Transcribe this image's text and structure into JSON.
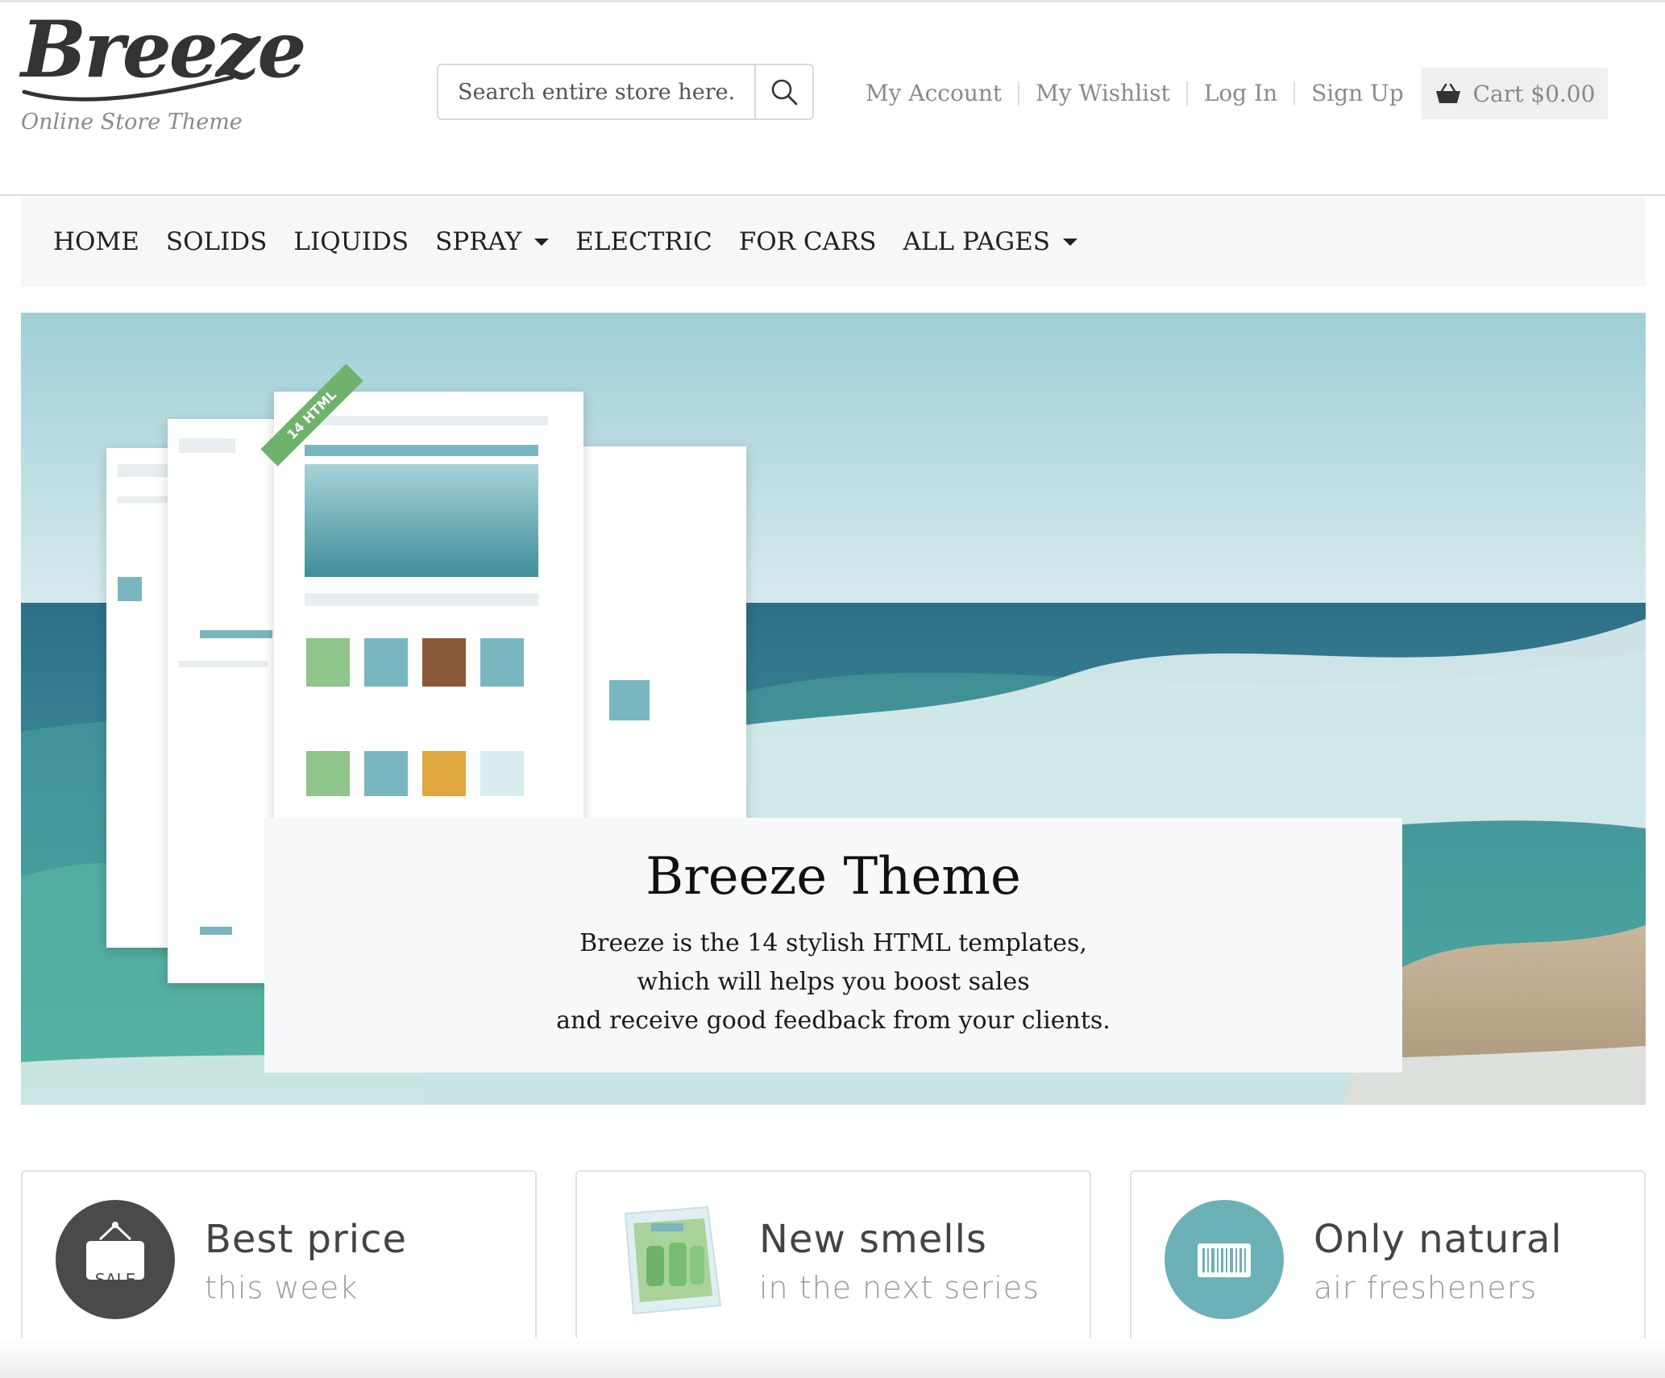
{
  "logo": {
    "name": "Breeze",
    "tagline": "Online Store Theme"
  },
  "search": {
    "placeholder": "Search entire store here..."
  },
  "account_links": [
    "My Account",
    "My Wishlist",
    "Log In",
    "Sign Up"
  ],
  "cart": {
    "label": "Cart $0.00"
  },
  "nav": [
    {
      "label": "HOME",
      "dropdown": false
    },
    {
      "label": "SOLIDS",
      "dropdown": false
    },
    {
      "label": "LIQUIDS",
      "dropdown": false
    },
    {
      "label": "SPRAY",
      "dropdown": true
    },
    {
      "label": "ELECTRIC",
      "dropdown": false
    },
    {
      "label": "FOR CARS",
      "dropdown": false
    },
    {
      "label": "ALL PAGES",
      "dropdown": true
    }
  ],
  "hero": {
    "ribbon": "14 HTML",
    "title": "Breeze Theme",
    "text": [
      "Breeze is the 14 stylish HTML templates,",
      "which will helps you boost sales",
      "and receive good feedback from your clients."
    ]
  },
  "features": [
    {
      "title": "Best price",
      "subtitle": "this week",
      "icon": "sale-tag-icon",
      "badge": "SALE"
    },
    {
      "title": "New smells",
      "subtitle": "in the next series",
      "icon": "air-freshener-product-icon"
    },
    {
      "title": "Only natural",
      "subtitle": "air fresheners",
      "icon": "barcode-icon"
    }
  ],
  "colors": {
    "accent_teal": "#6cb0b8",
    "dark_icon": "#4a4a4a",
    "nav_bg": "#f6f7f8",
    "ribbon_green": "#6fb26c"
  }
}
